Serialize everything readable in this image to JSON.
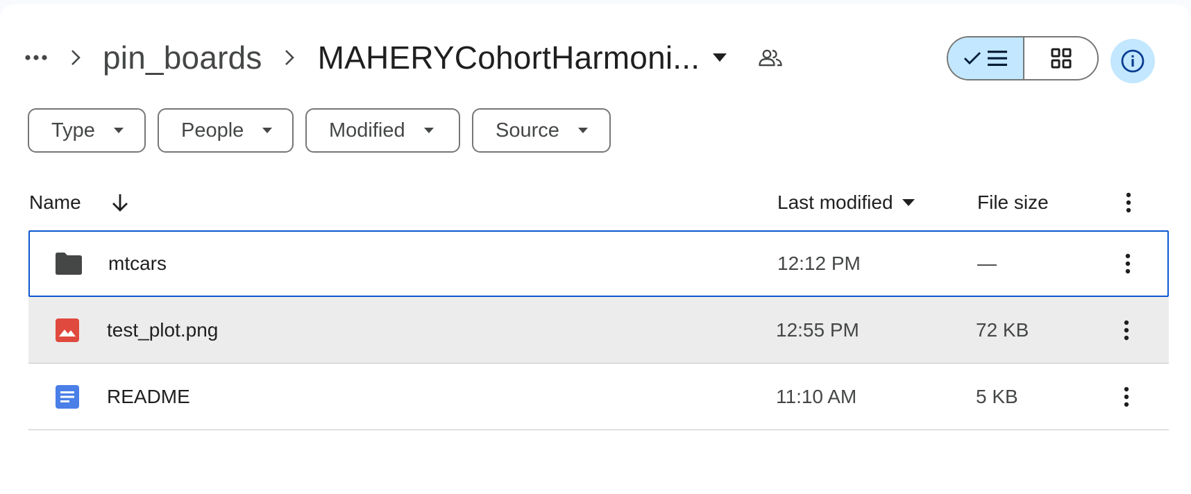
{
  "breadcrumb": {
    "more_label": "More folders",
    "folder": "pin_boards",
    "current": "MAHERYCohortHarmoni..."
  },
  "filters": [
    "Type",
    "People",
    "Modified",
    "Source"
  ],
  "table": {
    "headers": {
      "name": "Name",
      "last_modified": "Last modified",
      "file_size": "File size"
    },
    "rows": [
      {
        "name": "mtcars",
        "modified": "12:12 PM",
        "size": "—",
        "icon": "folder-icon"
      },
      {
        "name": "test_plot.png",
        "modified": "12:55 PM",
        "size": "72 KB",
        "icon": "image-icon"
      },
      {
        "name": "README",
        "modified": "11:10 AM",
        "size": "5 KB",
        "icon": "docs-icon"
      }
    ]
  },
  "colors": {
    "accent": "#0b57d0",
    "toggle_bg": "#c2e7ff",
    "image_icon": "#e0493e",
    "docs_icon": "#4a7fe8",
    "folder_icon": "#444746"
  },
  "icons": [
    "more-horiz-icon",
    "chevron-right-icon",
    "caret-down-icon",
    "shared-people-icon",
    "check-icon",
    "list-view-icon",
    "grid-view-icon",
    "info-icon",
    "arrow-down-icon",
    "more-vert-icon"
  ]
}
